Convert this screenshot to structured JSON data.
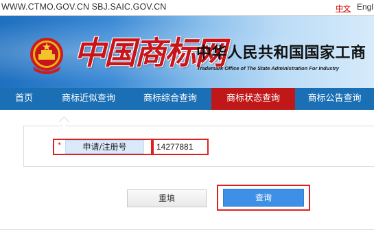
{
  "header": {
    "site_urls": "WWW.CTMO.GOV.CN SBJ.SAIC.GOV.CN",
    "lang_zh": "中文",
    "lang_en": "Engl"
  },
  "banner": {
    "logo_text": "中国商标网",
    "org_title": "中华人民共和国国家工商",
    "org_subtitle": "Trademark Office of The State Administration For Industry"
  },
  "nav": {
    "items": [
      {
        "label": "首页",
        "active": false
      },
      {
        "label": "商标近似查询",
        "active": false
      },
      {
        "label": "商标综合查询",
        "active": false
      },
      {
        "label": "商标状态查询",
        "active": true
      },
      {
        "label": "商标公告查询",
        "active": false
      }
    ]
  },
  "form": {
    "required_mark": "*",
    "field_label": "申请/注册号",
    "field_value": "14277881"
  },
  "buttons": {
    "reset_label": "重填",
    "query_label": "查询"
  },
  "colors": {
    "nav_bg": "#1a6fb5",
    "nav_active": "#c01818",
    "highlight_border": "#e02020",
    "query_button": "#3e8fe6"
  }
}
